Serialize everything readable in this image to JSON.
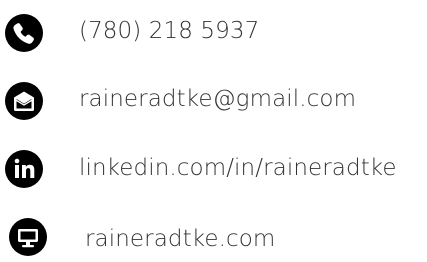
{
  "contacts": {
    "phone": {
      "icon": "phone-icon",
      "text": "(780) 218 5937"
    },
    "email": {
      "icon": "envelope-icon",
      "text": "raineradtke@gmail.com"
    },
    "linkedin": {
      "icon": "linkedin-icon",
      "text": "linkedin.com/in/raineradtke"
    },
    "website": {
      "icon": "monitor-icon",
      "text": "raineradtke.com"
    }
  },
  "colors": {
    "icon_background": "#000000",
    "icon_glyph": "#ffffff",
    "text": "#333333"
  }
}
